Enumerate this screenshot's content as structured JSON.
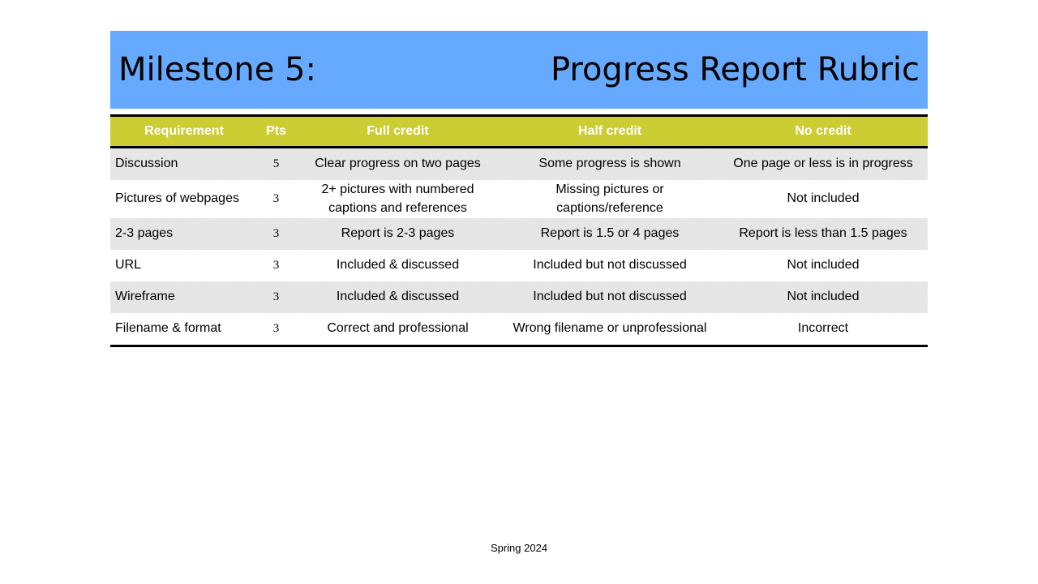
{
  "title": {
    "left": "Milestone 5:",
    "right": "Progress Report Rubric",
    "background": "#66aaff"
  },
  "table": {
    "header_background": "#cccc33",
    "columns": [
      "Requirement",
      "Pts",
      "Full credit",
      "Half credit",
      "No credit"
    ],
    "rows": [
      [
        "Discussion",
        "5",
        "Clear progress on two pages",
        "Some progress is shown",
        "One page or less is in progress"
      ],
      [
        "Pictures of webpages",
        "3",
        "2+ pictures with numbered captions and references",
        "Missing pictures or captions/reference",
        "Not included"
      ],
      [
        "2-3 pages",
        "3",
        "Report is 2-3 pages",
        "Report is 1.5 or 4 pages",
        "Report is less than 1.5 pages"
      ],
      [
        "URL",
        "3",
        "Included & discussed",
        "Included but not discussed",
        "Not included"
      ],
      [
        "Wireframe",
        "3",
        "Included & discussed",
        "Included but not discussed",
        "Not included"
      ],
      [
        "Filename & format",
        "3",
        "Correct and professional",
        "Wrong filename or unprofessional",
        "Incorrect"
      ]
    ]
  },
  "footer": "Spring 2024"
}
